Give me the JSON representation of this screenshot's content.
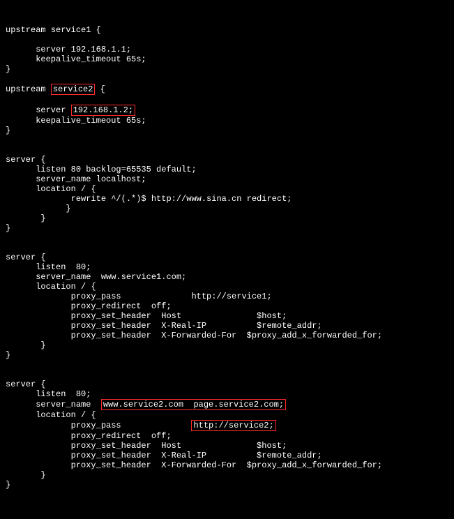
{
  "upstream1": {
    "header_prefix": "upstream ",
    "name": "service1",
    "header_suffix": " {",
    "server_line": "      server 192.168.1.1;",
    "keepalive_line": "      keepalive_timeout 65s;",
    "close": "}"
  },
  "upstream2": {
    "header_prefix": "upstream ",
    "name": "service2",
    "header_suffix": " {",
    "blank": "",
    "server_indent": "      server ",
    "server_value": "192.168.1.2;",
    "keepalive_line": "      keepalive_timeout 65s;",
    "close": "}"
  },
  "server1": {
    "open": "server {",
    "listen": "      listen 80 backlog=65535 default;",
    "server_name": "      server_name localhost;",
    "loc_open": "      location / {",
    "rewrite": "             rewrite ^/(.*)$ http://www.sina.cn redirect;",
    "loc_close": "            }",
    "inner_close": "       }",
    "close": "}"
  },
  "server2": {
    "open": "server {",
    "listen": "      listen  80;",
    "server_name": "      server_name  www.service1.com;",
    "loc_open": "      location / {",
    "proxy_pass": "             proxy_pass              http://service1;",
    "proxy_redirect": "             proxy_redirect  off;",
    "proxy_host": "             proxy_set_header  Host               $host;",
    "proxy_realip": "             proxy_set_header  X-Real-IP          $remote_addr;",
    "proxy_fwd": "             proxy_set_header  X-Forwarded-For  $proxy_add_x_forwarded_for;",
    "loc_close": "       }",
    "close": "}"
  },
  "server3": {
    "open": "server {",
    "listen": "      listen  80;",
    "server_name_prefix": "      server_name  ",
    "server_name_value": "www.service2.com  page.service2.com;",
    "loc_open": "      location / {",
    "proxy_pass_prefix": "             proxy_pass              ",
    "proxy_pass_value": "http://service2;",
    "proxy_redirect": "             proxy_redirect  off;",
    "proxy_host": "             proxy_set_header  Host               $host;",
    "proxy_realip": "             proxy_set_header  X-Real-IP          $remote_addr;",
    "proxy_fwd": "             proxy_set_header  X-Forwarded-For  $proxy_add_x_forwarded_for;",
    "loc_close": "       }",
    "close": "}"
  }
}
